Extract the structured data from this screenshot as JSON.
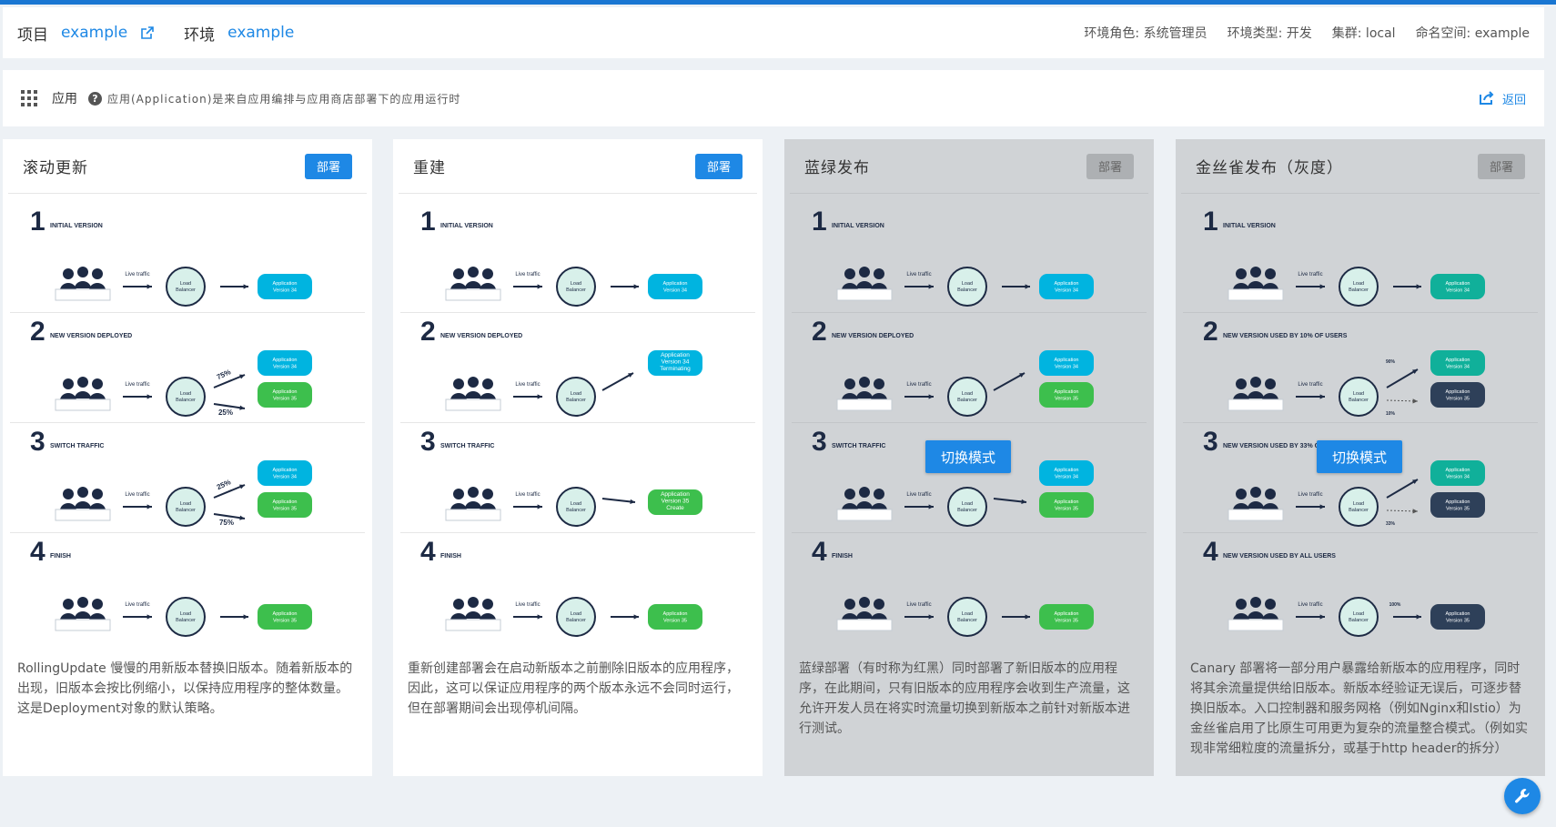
{
  "header": {
    "project_label": "项目",
    "project_value": "example",
    "env_label": "环境",
    "env_value": "example",
    "meta": [
      "环境角色: 系统管理员",
      "环境类型: 开发",
      "集群: local",
      "命名空间: example"
    ]
  },
  "appbar": {
    "title": "应用",
    "description": "应用(Application)是来自应用编排与应用商店部署下的应用运行时",
    "back_label": "返回"
  },
  "cards": [
    {
      "title": "滚动更新",
      "deploy": "部署",
      "enabled": true,
      "text": "RollingUpdate 慢慢的用新版本替换旧版本。随着新版本的出现，旧版本会按比例缩小，以保持应用程序的整体数量。这是Deployment对象的默认策略。",
      "stages": [
        "INITIAL VERSION",
        "NEW VERSION DEPLOYED",
        "SWITCH TRAFFIC",
        "FINISH"
      ]
    },
    {
      "title": "重建",
      "deploy": "部署",
      "enabled": true,
      "text": "重新创建部署会在启动新版本之前删除旧版本的应用程序，因此，这可以保证应用程序的两个版本永远不会同时运行，但在部署期间会出现停机间隔。",
      "stages": [
        "INITIAL VERSION",
        "NEW VERSION DEPLOYED",
        "SWITCH TRAFFIC",
        "FINISH"
      ]
    },
    {
      "title": "蓝绿发布",
      "deploy": "部署",
      "enabled": false,
      "switch_label": "切换模式",
      "text": "蓝绿部署（有时称为红黑）同时部署了新旧版本的应用程序，在此期间，只有旧版本的应用程序会收到生产流量，这允许开发人员在将实时流量切换到新版本之前针对新版本进行测试。",
      "stages": [
        "INITIAL VERSION",
        "NEW VERSION DEPLOYED",
        "SWITCH TRAFFIC",
        "FINISH"
      ]
    },
    {
      "title": "金丝雀发布（灰度）",
      "deploy": "部署",
      "enabled": false,
      "switch_label": "切换模式",
      "text": "Canary 部署将一部分用户暴露给新版本的应用程序，同时将其余流量提供给旧版本。新版本经验证无误后，可逐步替换旧版本。入口控制器和服务网格（例如Nginx和Istio）为金丝雀启用了比原生可用更为复杂的流量整合模式。（例如实现非常细粒度的流量拆分，或基于http header的拆分）",
      "stages": [
        "INITIAL VERSION",
        "NEW VERSION USED BY 10% OF USERS",
        "NEW VERSION USED BY 33% OF USERS",
        "NEW VERSION USED BY ALL USERS"
      ]
    }
  ],
  "diagram_labels": {
    "users": "Users",
    "live_traffic": "Live traffic",
    "lb_line1": "Load",
    "lb_line2": "Balancer",
    "app_line1": "Application",
    "v34": "Version 34",
    "v35": "Version 35",
    "terminating": "Terminating",
    "create": "Create",
    "pct_75": "75%",
    "pct_25": "25%",
    "pct_90": "90%",
    "pct_10": "10%",
    "pct_66": "66%",
    "pct_33": "33%",
    "pct_100": "100%"
  },
  "colors": {
    "accent": "#1e88e5",
    "v34": "#00b4e0",
    "v35": "#3dbf4d",
    "canary_v34": "#10b09a",
    "canary_v35": "#2e4059",
    "lb_fill": "#d8f0ea",
    "navy": "#1d2a44"
  }
}
